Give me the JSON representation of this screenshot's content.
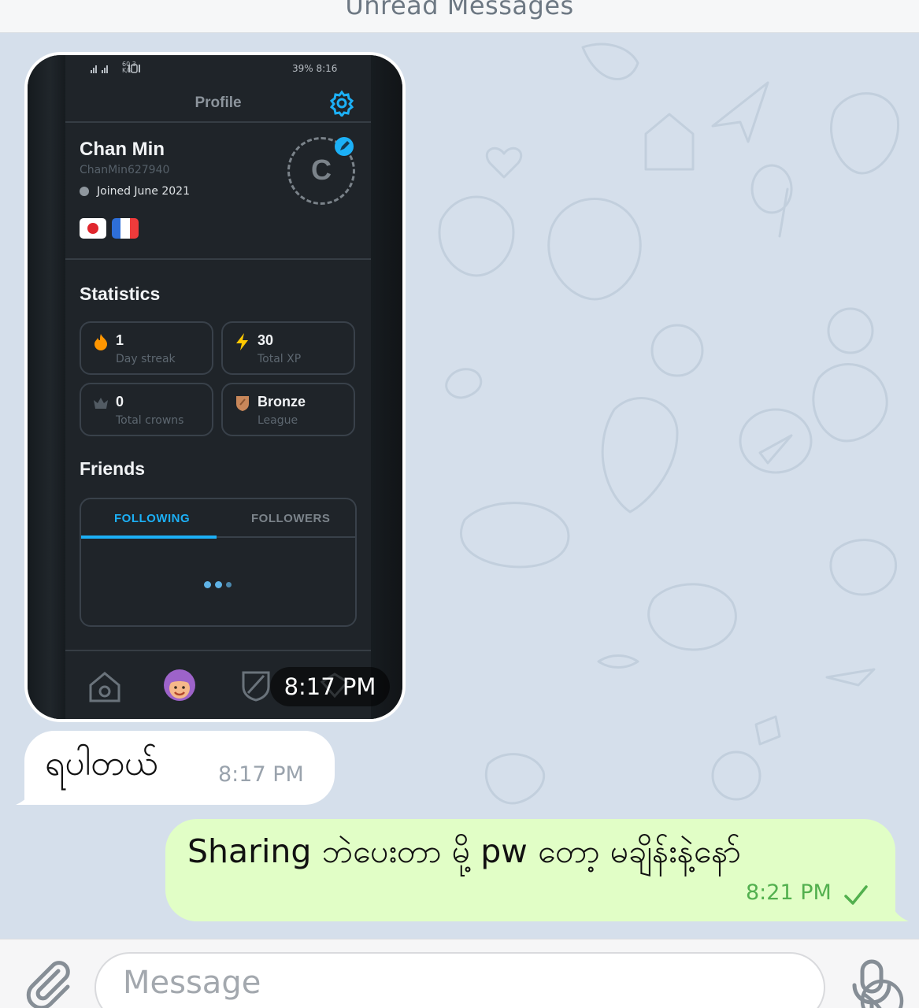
{
  "header": {
    "unread_label": "Unread Messages"
  },
  "screenshot": {
    "status_left": "60.3 K/s",
    "status_right": "39% 8:16",
    "title": "Profile",
    "profile": {
      "name": "Chan Min",
      "username": "ChanMin627940",
      "joined": "Joined June 2021",
      "avatar_letter": "C",
      "flags": [
        "japan",
        "france"
      ]
    },
    "statistics_title": "Statistics",
    "stats": [
      {
        "value": "1",
        "label": "Day streak",
        "icon": "fire-icon"
      },
      {
        "value": "30",
        "label": "Total XP",
        "icon": "lightning-icon"
      },
      {
        "value": "0",
        "label": "Total crowns",
        "icon": "crown-icon"
      },
      {
        "value": "Bronze",
        "label": "League",
        "icon": "bronze-shield-icon"
      }
    ],
    "friends_title": "Friends",
    "tabs": {
      "following": "FOLLOWING",
      "followers": "FOLLOWERS"
    },
    "nav_icons": [
      "home-icon",
      "profile-avatar-icon",
      "league-shield-icon",
      "shop-icon"
    ]
  },
  "messages": [
    {
      "type": "photo",
      "time": "8:17 PM",
      "direction": "incoming"
    },
    {
      "type": "text",
      "text": "ရပါတယ်",
      "time": "8:17 PM",
      "direction": "incoming"
    },
    {
      "type": "text",
      "text": "Sharing ဘဲပေးတာ မို့ pw တော့ မချိန်းနဲ့နော်",
      "time": "8:21 PM",
      "direction": "outgoing",
      "status": "sent"
    }
  ],
  "input": {
    "placeholder": "Message"
  },
  "colors": {
    "chat_background": "#d5dfeb",
    "outgoing_bubble": "#e1fec6",
    "outgoing_time": "#52b04e",
    "duolingo_blue": "#1cb0f6"
  }
}
